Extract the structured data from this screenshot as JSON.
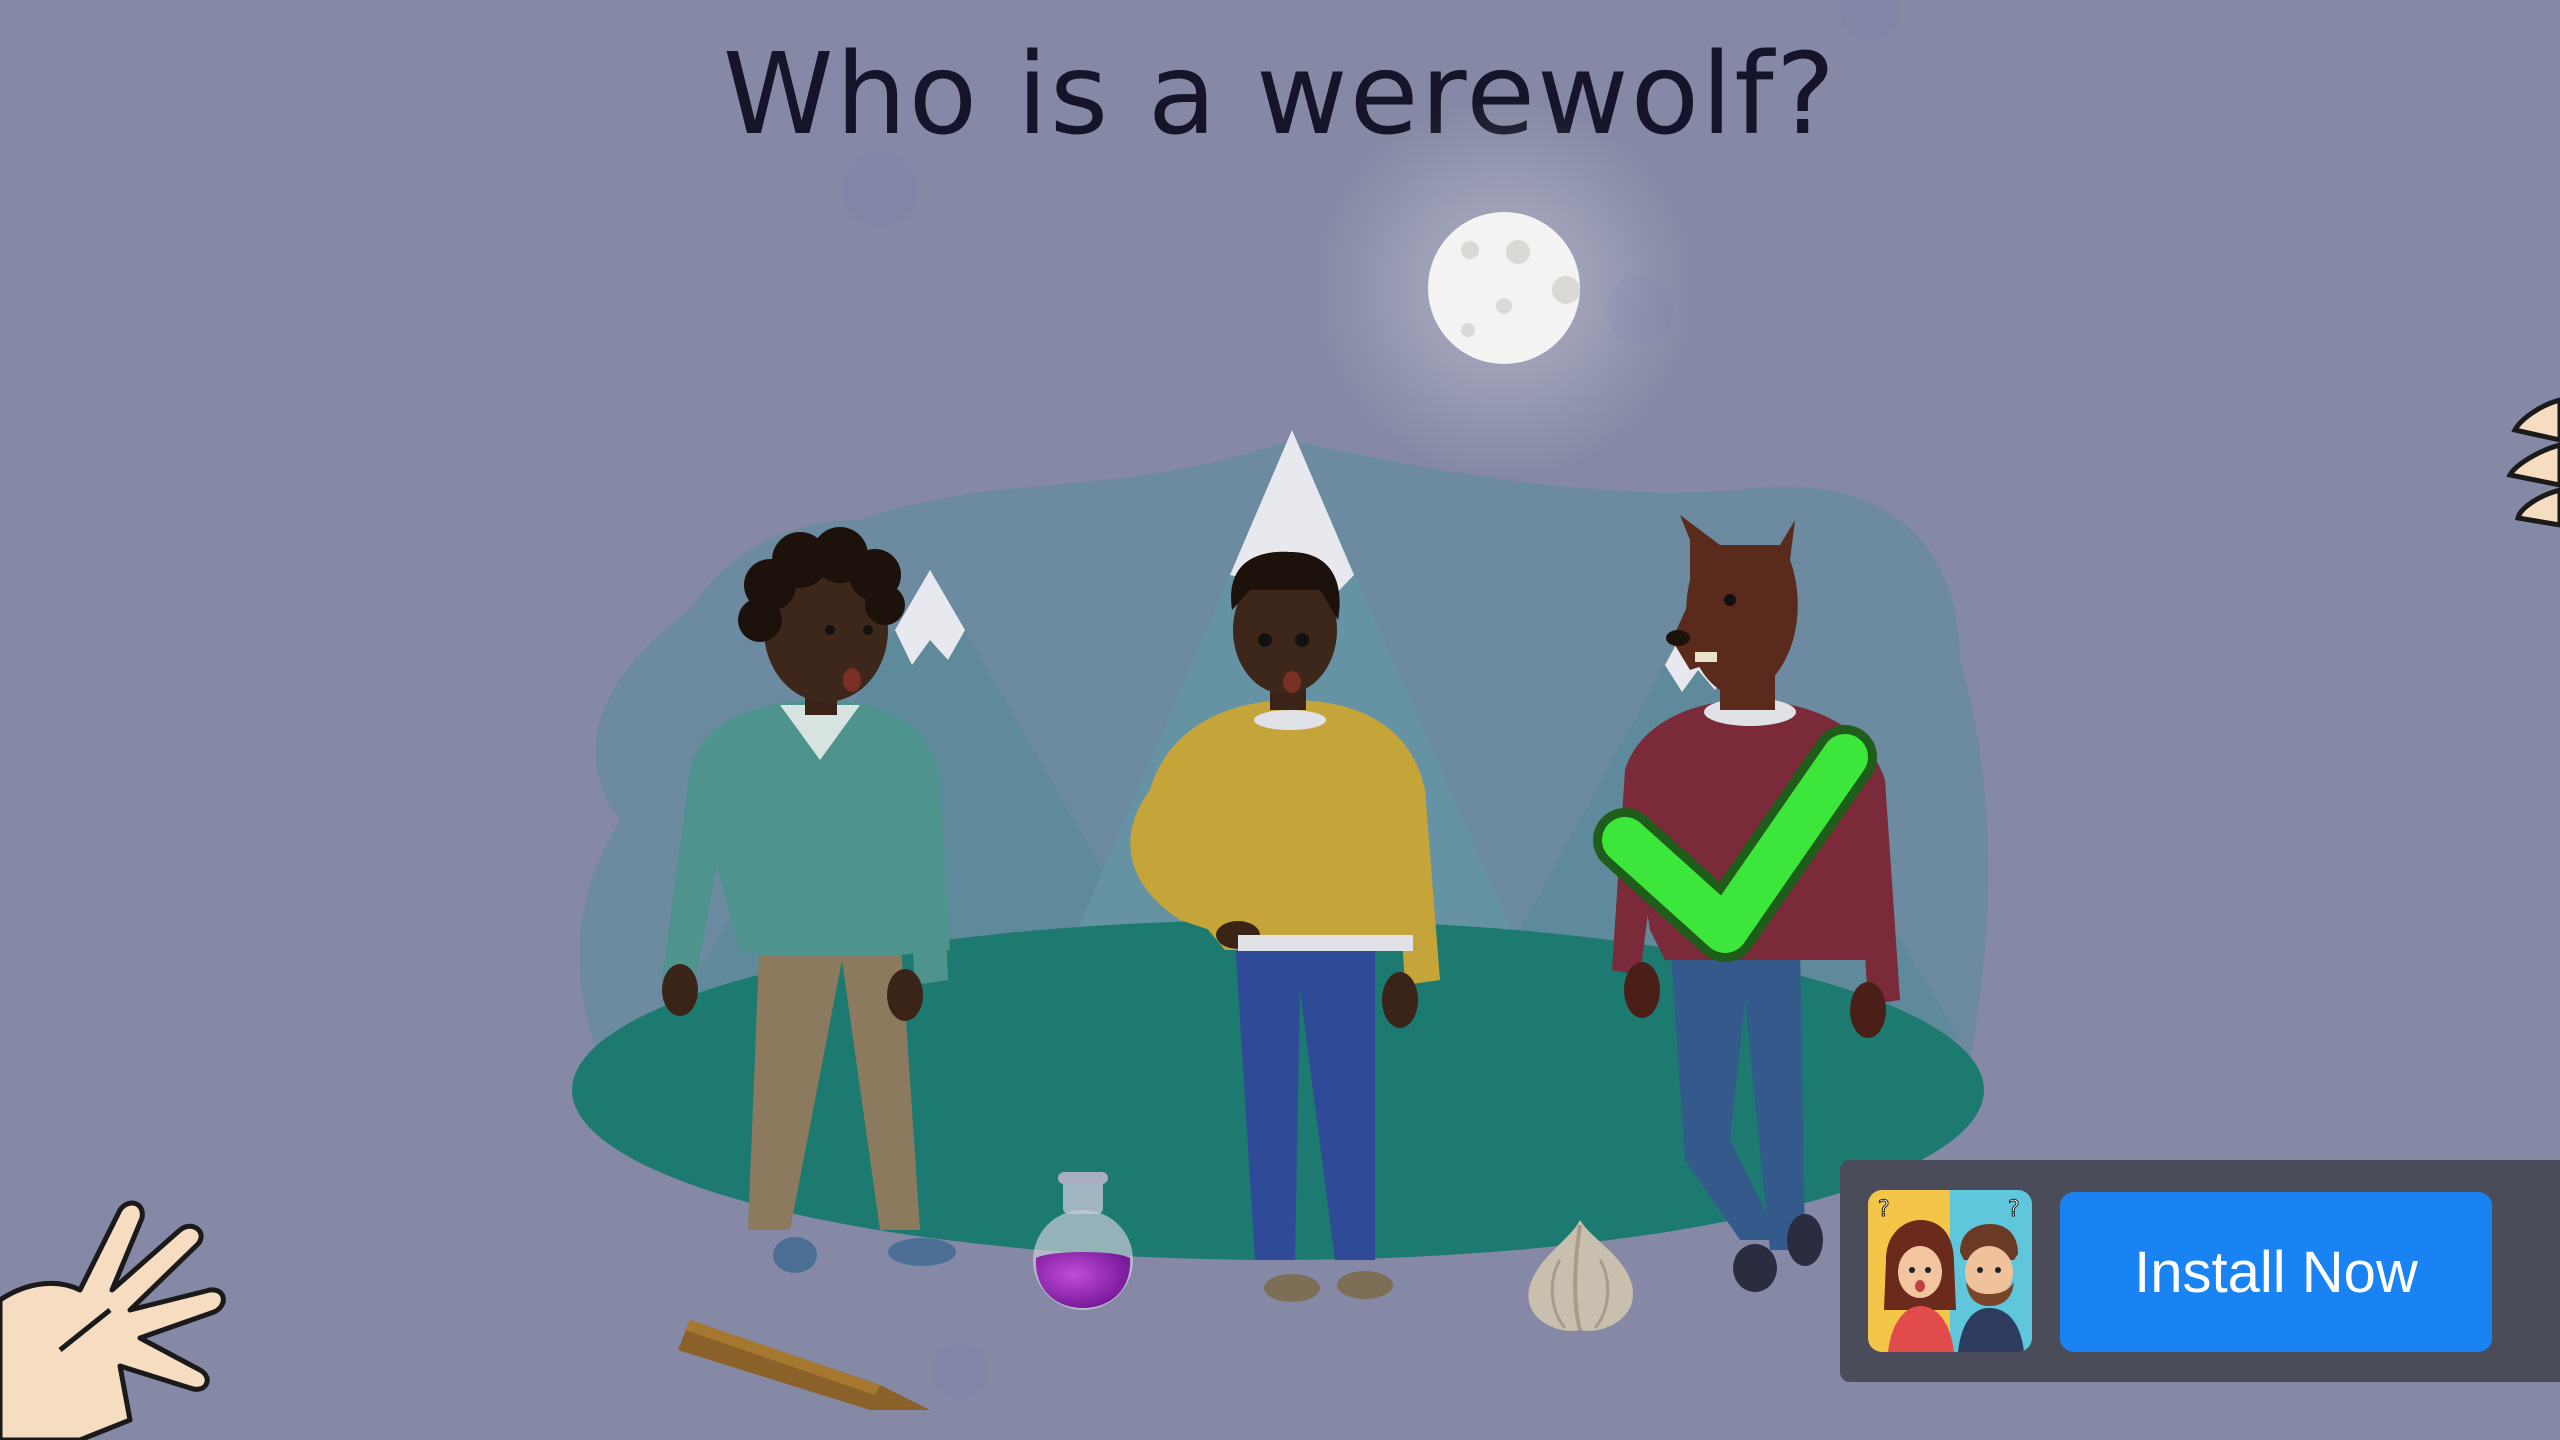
{
  "question": "Who is a werewolf?",
  "ad": {
    "install_label": "Install Now",
    "icon": "couple-app-icon"
  },
  "colors": {
    "background": "#8589a5",
    "ground": "#1d7a70",
    "checkmark": "#3de63a",
    "button": "#1a83f3"
  },
  "scene": {
    "characters": [
      "man-green-sweater",
      "man-yellow-sweater",
      "werewolf-red-sweater"
    ],
    "answer": "werewolf-red-sweater",
    "items": [
      "wooden-stake",
      "purple-potion",
      "garlic-bulb"
    ]
  }
}
